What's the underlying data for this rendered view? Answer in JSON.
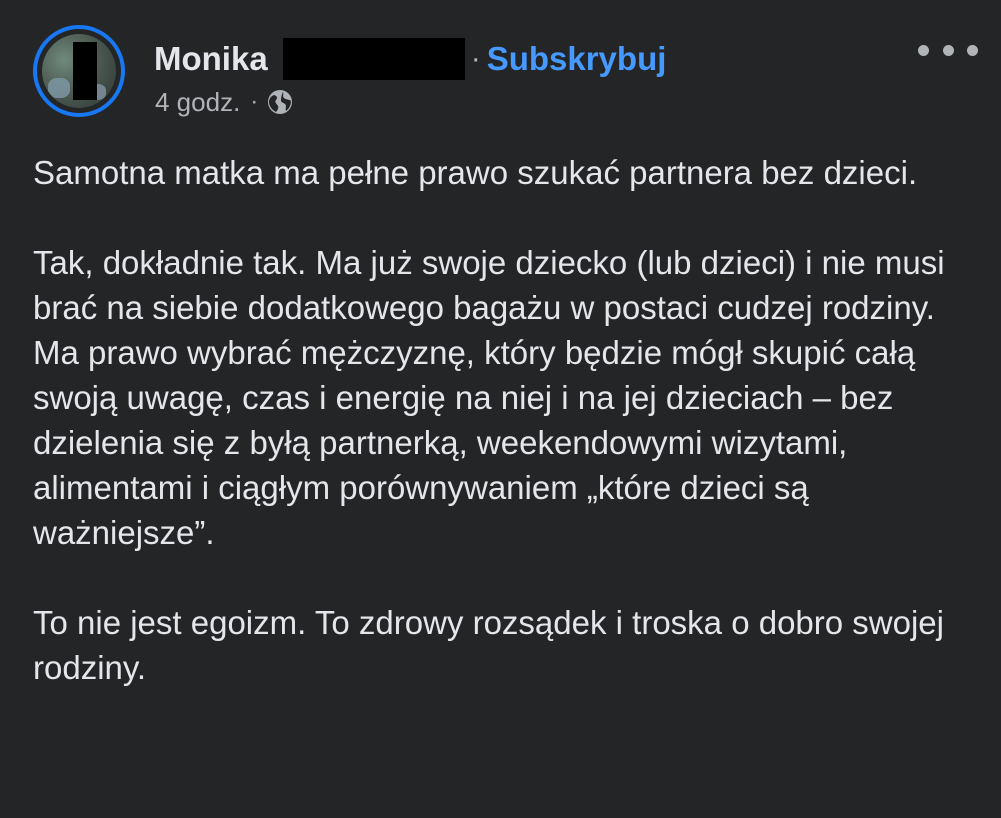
{
  "post": {
    "author_name": "Monika",
    "separator": "·",
    "subscribe_label": "Subskrybuj",
    "time_ago": "4 godz.",
    "meta_separator": "·",
    "privacy_icon": "globe-icon",
    "more_icon": "more-horizontal-icon",
    "avatar_ring_color": "#1877f2",
    "link_color": "#4599ff",
    "body": {
      "p1": "Samotna matka ma pełne prawo szukać partnera bez dzieci.",
      "p2": "Tak, dokładnie tak. Ma już swoje dziecko (lub dzieci) i nie musi brać na siebie dodatkowego bagażu w postaci cudzej rodziny.",
      "p3": "Ma prawo wybrać mężczyznę, który będzie mógł skupić całą swoją uwagę, czas i energię na niej i na jej dzieciach – bez dzielenia się z byłą partnerką, weekendowymi wizytami, alimentami i ciągłym porównywaniem „które dzieci są ważniejsze”.",
      "p4": "To nie jest egoizm. To zdrowy rozsądek i troska o dobro swojej rodziny."
    }
  }
}
